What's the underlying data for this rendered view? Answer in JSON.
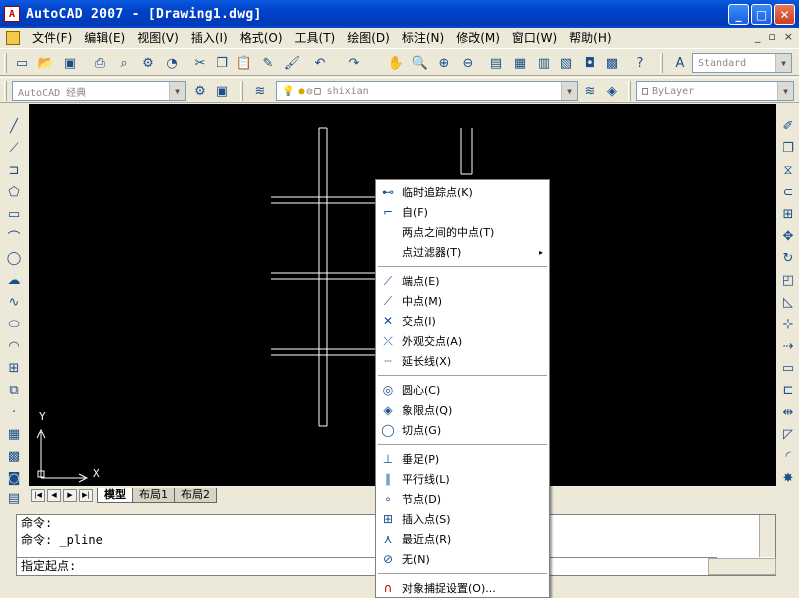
{
  "window": {
    "title": "AutoCAD 2007 - [Drawing1.dwg]",
    "logo": "A",
    "btn_min": "_",
    "btn_max": "□",
    "btn_close": "✕"
  },
  "menubar": {
    "items": [
      "文件(F)",
      "编辑(E)",
      "视图(V)",
      "插入(I)",
      "格式(O)",
      "工具(T)",
      "绘图(D)",
      "标注(N)",
      "修改(M)",
      "窗口(W)",
      "帮助(H)"
    ],
    "mdi_min": "_",
    "mdi_restore": "▫",
    "mdi_close": "×"
  },
  "toolbar1": {
    "style_combo": "Standard"
  },
  "toolbar2": {
    "workspace_combo": "AutoCAD 经典",
    "layer_combo": "shixian",
    "color_combo": "ByLayer"
  },
  "canvas": {
    "ucs_x": "X",
    "ucs_y": "Y"
  },
  "tabs": {
    "model": "模型",
    "layout1": "布局1",
    "layout2": "布局2",
    "nav": [
      "|◀",
      "◀",
      "▶",
      "▶|"
    ]
  },
  "command": {
    "line1": "命令:",
    "line2": "命令: _pline",
    "prompt": "指定起点:"
  },
  "context_menu": {
    "items": [
      {
        "label": "临时追踪点(K)",
        "icon": "track-point-icon",
        "glyph": "⊷"
      },
      {
        "label": "自(F)",
        "icon": "from-icon",
        "glyph": "⌐"
      },
      {
        "label": "两点之间的中点(T)",
        "icon": "",
        "glyph": ""
      },
      {
        "label": "点过滤器(T)",
        "icon": "",
        "glyph": "",
        "submenu": "▸"
      },
      {
        "label": "端点(E)",
        "icon": "endpoint-icon",
        "glyph": "⟋"
      },
      {
        "label": "中点(M)",
        "icon": "midpoint-icon",
        "glyph": "⟋"
      },
      {
        "label": "交点(I)",
        "icon": "intersection-icon",
        "glyph": "✕"
      },
      {
        "label": "外观交点(A)",
        "icon": "apparent-intersection-icon",
        "glyph": "⤫"
      },
      {
        "label": "延长线(X)",
        "icon": "extension-icon",
        "glyph": "┈"
      },
      {
        "label": "圆心(C)",
        "icon": "center-icon",
        "glyph": "◎"
      },
      {
        "label": "象限点(Q)",
        "icon": "quadrant-icon",
        "glyph": "◈"
      },
      {
        "label": "切点(G)",
        "icon": "tangent-icon",
        "glyph": "◯"
      },
      {
        "label": "垂足(P)",
        "icon": "perpendicular-icon",
        "glyph": "⊥"
      },
      {
        "label": "平行线(L)",
        "icon": "parallel-icon",
        "glyph": "∥"
      },
      {
        "label": "节点(D)",
        "icon": "node-icon",
        "glyph": "∘"
      },
      {
        "label": "插入点(S)",
        "icon": "insert-icon",
        "glyph": "⊞"
      },
      {
        "label": "最近点(R)",
        "icon": "nearest-icon",
        "glyph": "⋏"
      },
      {
        "label": "无(N)",
        "icon": "none-icon",
        "glyph": "⊘"
      },
      {
        "label": "对象捕捉设置(O)...",
        "icon": "osnap-settings-icon",
        "glyph": "∩"
      }
    ]
  }
}
